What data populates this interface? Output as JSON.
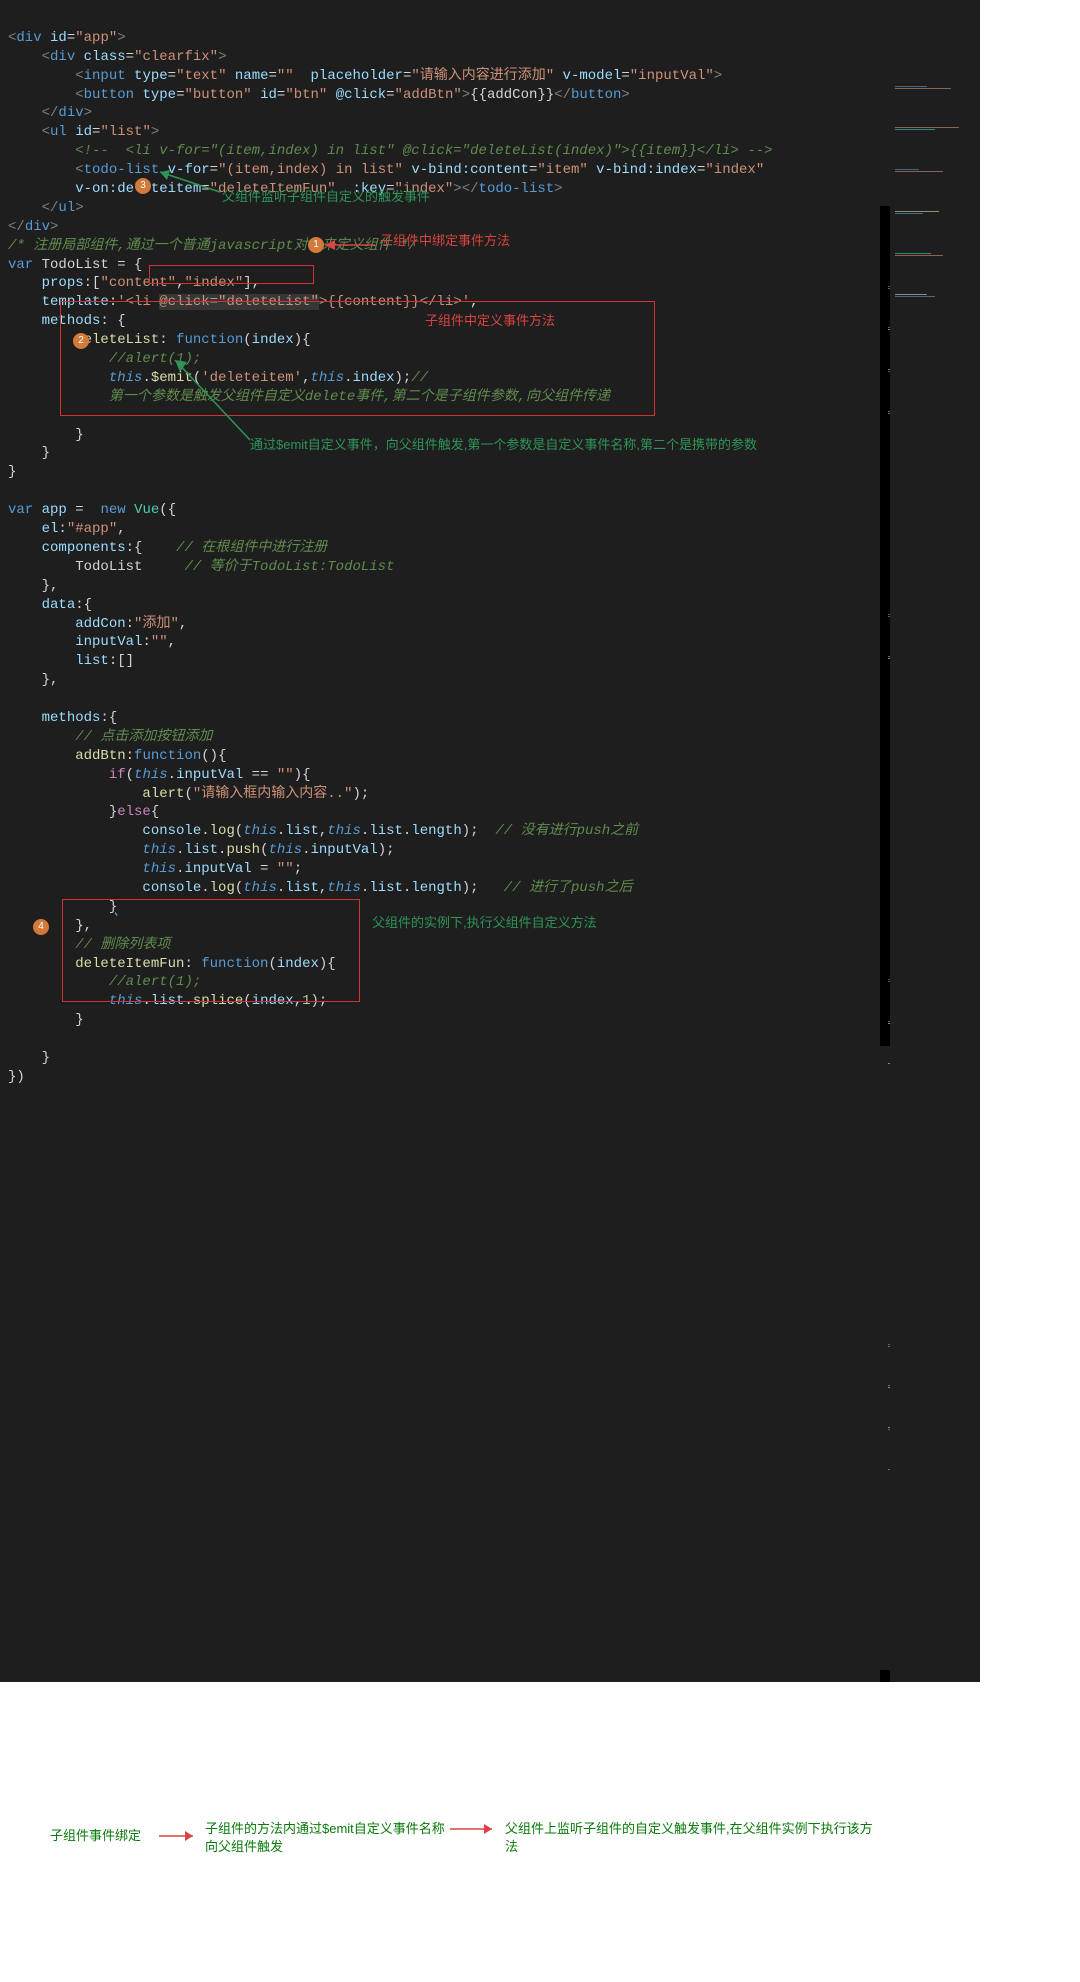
{
  "code": {
    "l1": {
      "t": "<",
      "div": "div",
      "sp": " ",
      "id": "id",
      "eq": "=",
      "v": "\"app\"",
      "gt": ">"
    },
    "l2": {
      "t": "    <",
      "div": "div",
      "sp": " ",
      "cls": "class",
      "eq": "=",
      "v": "\"clearfix\"",
      "gt": ">"
    },
    "l3": {
      "pre": "        <",
      "input": "input",
      "a1": " type",
      "v1": "=\"text\"",
      "a2": " name",
      "v2": "=\"\"",
      "a3": "  placeholder",
      "v3": "=\"请输入内容进行添加\"",
      "a4": " v-model",
      "v4": "=\"inputVal\"",
      "gt": ">"
    },
    "l4": {
      "pre": "        <",
      "btn": "button",
      "a1": " type",
      "v1": "=\"button\"",
      "a2": " id",
      "v2": "=\"btn\"",
      "a3": " @click",
      "v3": "=\"addBtn\"",
      "gt": ">",
      "inter": "{{addCon}}",
      "close": "</",
      "btn2": "button",
      "gt2": ">"
    },
    "l5": {
      "t": "    </",
      "div": "div",
      "gt": ">"
    },
    "l6": {
      "t": "    <",
      "ul": "ul",
      "a": " id",
      "v": "=\"list\"",
      "gt": ">"
    },
    "l7": {
      "com": "        <!--  <li v-for=\"(item,index) in list\" @click=\"deleteList(index)\">{{item}}</li> -->"
    },
    "l8": {
      "pre": "        <",
      "tl": "todo-list",
      "a1": " v-for",
      "v1": "=\"(item,index) in list\"",
      "a2": " v-bind:content",
      "v2": "=\"item\"",
      "a3": " v-bind:index",
      "v3": "=\"index\""
    },
    "l9": {
      "pre": "        ",
      "a1": "v-on:deleteitem",
      "v1": "=\"deleteItemFun\"",
      "a2": "  :key",
      "v2": "=\"index\"",
      "close": "></",
      "tl": "todo-list",
      "gt": ">"
    },
    "l10": {
      "t": "    </",
      "ul": "ul",
      "gt": ">"
    },
    "l11": {
      "t": "</",
      "div": "div",
      "gt": ">"
    },
    "l12": {
      "com": "/* 注册局部组件,通过一个普通javascript对象来定义组件 */"
    },
    "l13": {
      "var": "var",
      "sp": " ",
      "name": "TodoList",
      "eq": " = {"
    },
    "l14": {
      "pre": "    ",
      "props": "props",
      ":": ":",
      "val": "[\"content\",\"index\"]",
      ",": ","
    },
    "l15": {
      "pre": "    ",
      "tpl": "template",
      ":": ":",
      "q": "'",
      "open": "<li ",
      "click": "@click=\"deleteList\"",
      "close": ">{{content}}</li>",
      "q2": "',"
    },
    "l16": {
      "pre": "    ",
      "m": "methods",
      ":": ": {"
    },
    "l17": {
      "pre": "        ",
      "name": "deleteList",
      ":": ": ",
      "fn": "function",
      "p": "(",
      "idx": "index",
      "p2": "){"
    },
    "l18": {
      "pre": "            ",
      "com": "//alert(1);"
    },
    "l19a": {
      "pre": "            ",
      "this": "this",
      ".": ".",
      "emit": "$emit",
      "p": "(",
      "s": "'deleteitem'",
      ",": ",",
      "this2": "this",
      ".2": ".",
      "idx": "index",
      ")": ");",
      "com": "//"
    },
    "l19b": {
      "pre": "            ",
      "com": "第一个参数是触发父组件自定义delete事件,第二个是子组件参数,向父组件传递"
    },
    "l20": {
      "pre": "        }"
    },
    "l21": {
      "pre": "    }"
    },
    "l22": {
      "pre": "}"
    },
    "l24": {
      "var": "var",
      "sp": " ",
      "app": "app",
      " = ": " =  ",
      "new": "new",
      "sp2": " ",
      "Vue": "Vue",
      "p": "({"
    },
    "l25": {
      "pre": "    ",
      "el": "el",
      ":": ":",
      "v": "\"#app\"",
      ",": ","
    },
    "l26": {
      "pre": "    ",
      "comp": "components",
      ":": ":{",
      "com": "    // 在根组件中进行注册"
    },
    "l27": {
      "pre": "        ",
      "tl": "TodoList",
      "com": "     // 等价于TodoList:TodoList"
    },
    "l28": {
      "pre": "    },"
    },
    "l29": {
      "pre": "    ",
      "data": "data",
      ":": ":{"
    },
    "l30": {
      "pre": "        ",
      "k": "addCon",
      ":": ":",
      "v": "\"添加\"",
      ",": ","
    },
    "l31": {
      "pre": "        ",
      "k": "inputVal",
      ":": ":",
      "v": "\"\"",
      ",": ","
    },
    "l32": {
      "pre": "        ",
      "k": "list",
      ":": ":",
      "v": "[]"
    },
    "l33": {
      "pre": "    },"
    },
    "l35": {
      "pre": "    ",
      "m": "methods",
      ":": ":{"
    },
    "l36": {
      "pre": "        ",
      "com": "// 点击添加按钮添加"
    },
    "l37": {
      "pre": "        ",
      "name": "addBtn",
      ":": ":",
      "fn": "function",
      "p": "(){"
    },
    "l38": {
      "pre": "            ",
      "if": "if",
      "p": "(",
      "this": "this",
      ".": ".",
      "iv": "inputVal",
      "eq": " == ",
      "v": "\"\"",
      "p2": "){"
    },
    "l39": {
      "pre": "                ",
      "alert": "alert",
      "p": "(",
      "s": "\"请输入框内输入内容..\"",
      "p2": ");"
    },
    "l40": {
      "pre": "            }",
      "else": "else",
      "p": "{"
    },
    "l41": {
      "pre": "                ",
      "c": "console",
      ".": ".",
      "log": "log",
      "p": "(",
      "this": "this",
      ".2": ".",
      "list": "list",
      ",": ",",
      "this2": "this",
      ".3": ".",
      "list2": "list",
      ".4": ".",
      "len": "length",
      "p2": "); ",
      "com": " // 没有进行push之前"
    },
    "l42": {
      "pre": "                ",
      "this": "this",
      ".": ".",
      "list": "list",
      ".2": ".",
      "push": "push",
      "p": "(",
      "this2": "this",
      ".3": ".",
      "iv": "inputVal",
      "p2": ");"
    },
    "l43": {
      "pre": "                ",
      "this": "this",
      ".": ".",
      "iv": "inputVal",
      "eq": " = ",
      "v": "\"\"",
      "p": ";"
    },
    "l44": {
      "pre": "                ",
      "c": "console",
      ".": ".",
      "log": "log",
      "p": "(",
      "this": "this",
      ".2": ".",
      "list": "list",
      ",": ",",
      "this2": "this",
      ".3": ".",
      "list2": "list",
      ".4": ".",
      "len": "length",
      "p2": "); ",
      "com": "  // 进行了push之后"
    },
    "l45": {
      "pre": "            ",
      "u": "}"
    },
    "l46": {
      "pre": "        },"
    },
    "l47": {
      "pre": "        ",
      "com": "// 删除列表项"
    },
    "l48": {
      "pre": "        ",
      "name": "deleteItemFun",
      ":": ": ",
      "fn": "function",
      "p": "(",
      "idx": "index",
      "p2": "){"
    },
    "l49": {
      "pre": "            ",
      "com": "//alert(1);"
    },
    "l50": {
      "pre": "            ",
      "this": "this",
      ".": ".",
      "list": "list",
      ".2": ".",
      "splice": "splice",
      "p": "(",
      "idx": "index",
      ",": ",",
      "n": "1",
      "p2": ");"
    },
    "l51": {
      "pre": "        }"
    },
    "l53": {
      "pre": "    }"
    },
    "l54": {
      "pre": "})"
    }
  },
  "annotations": {
    "a_parent_listen": "父组件监听子组件自定义的触发事件",
    "a_child_bind": "子组件中绑定事件方法",
    "a_child_define": "子组件中定义事件方法",
    "a_emit_desc": "通过$emit自定义事件，向父组件触发,第一个参数是自定义事件名称,第二个是携带的参数",
    "a_parent_exec": "父组件的实例下,执行父组件自定义方法"
  },
  "badges": {
    "1": "1",
    "2": "2",
    "3": "3",
    "4": "4"
  },
  "legend": {
    "step1": "子组件事件绑定",
    "step2": "子组件的方法内通过$emit自定义事件名称向父组件触发",
    "step3": "父组件上监听子组件的自定义触发事件,在父组件实例下执行该方法"
  }
}
